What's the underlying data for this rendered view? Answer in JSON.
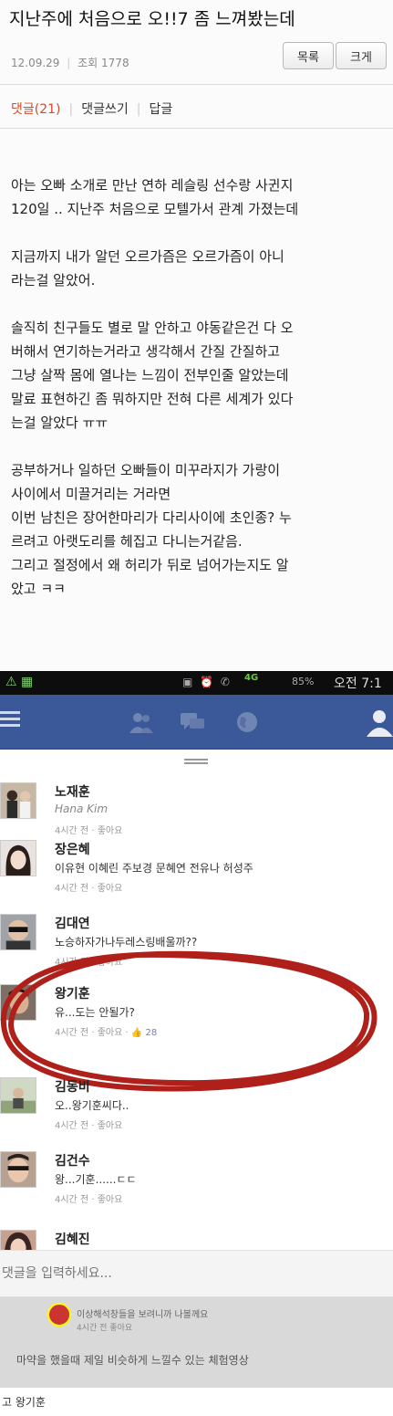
{
  "post": {
    "title": "지난주에 처음으로 오!!7 좀 느껴봤는데",
    "date": "12.09.29",
    "views_label": "조회 1778",
    "list_button": "목록",
    "big_button": "크게",
    "tabs": {
      "comments": "댓글(21)",
      "write": "댓글쓰기",
      "reply": "답글"
    },
    "body": [
      "아는 오빠 소개로 만난 연하 레슬링 선수랑 사귄지",
      "120일 .. 지난주 처음으로 모텔가서 관계 가졌는데",
      "",
      "지금까지 내가 알던 오르가즘은 오르가즘이 아니",
      "라는걸 알았어.",
      "",
      "솔직히 친구들도 별로 말 안하고 야동같은건 다 오",
      "버해서 연기하는거라고 생각해서 간질 간질하고",
      "그냥 살짝 몸에 열나는 느낌이 전부인줄 알았는데",
      "말료 표현하긴 좀 뭐하지만 전혀 다른 세계가 있다",
      "는걸 알았다 ㅠㅠ",
      "",
      "공부하거나 일하던 오빠들이 미꾸라지가 가랑이",
      "사이에서 미끌거리는 거라면",
      "이번 남친은 장어한마리가 다리사이에 초인종? 누",
      "르려고 아랫도리를 헤집고 다니는거같음.",
      "그리고 절정에서 왜 허리가 뒤로 넘어가는지도 알",
      "았고 ㅋㅋ"
    ]
  },
  "status_bar": {
    "network": "4G",
    "battery": "85%",
    "time": "오전 7:1"
  },
  "comments": [
    {
      "name": "노재훈",
      "text": "Hana Kim",
      "meta": "4시간 전",
      "like": "좋아요",
      "likes": ""
    },
    {
      "name": "장은혜",
      "text": "이유현 이혜린 주보경 문혜연 전유나 허성주",
      "meta": "4시간 전",
      "like": "좋아요",
      "likes": ""
    },
    {
      "name": "김대연",
      "text": "노승하자가나두레스링배울까??",
      "meta": "4시간 전",
      "like": "좋아요",
      "likes": ""
    },
    {
      "name": "왕기훈",
      "text": "유...도는 안될가?",
      "meta": "4시간 전",
      "like": "좋아요",
      "likes": "28"
    },
    {
      "name": "김동비",
      "text": "오..왕기훈씨다..",
      "meta": "4시간 전",
      "like": "좋아요",
      "likes": ""
    },
    {
      "name": "김건수",
      "text": "왕...기훈......ㄷㄷ",
      "meta": "4시간 전",
      "like": "좋아요",
      "likes": ""
    },
    {
      "name": "김혜진",
      "text": "",
      "meta": "",
      "like": "",
      "likes": ""
    }
  ],
  "comment_input": {
    "placeholder": "댓글을 입력하세요..."
  },
  "below_input": {
    "line1": "이상해석창들을 보려니까 나볼께요",
    "line2": "4시간 전 좋아요",
    "line3": "마약을 했을때 제일 비슷하게 느낄수 있는 체험영상"
  },
  "caption": "고 왕기훈",
  "colors": {
    "facebook_blue": "#3b5998",
    "accent_red": "#d24d2a",
    "circle_red": "#b0201a"
  }
}
